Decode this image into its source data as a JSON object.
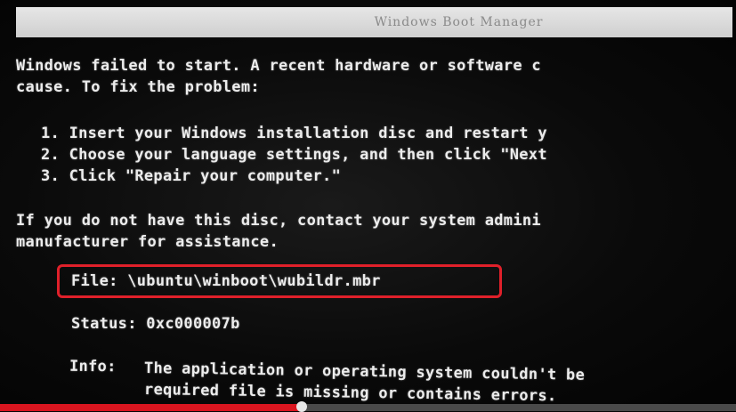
{
  "window": {
    "title": "Windows Boot Manager"
  },
  "message": {
    "line1": "Windows failed to start. A recent hardware or software c",
    "line2": "cause. To fix the problem:",
    "steps": [
      "1. Insert your Windows installation disc and restart y",
      "2. Choose your language settings, and then click \"Next",
      "3. Click \"Repair your computer.\""
    ],
    "line3": "If you do not have this disc, contact your system admini",
    "line4": "manufacturer for assistance."
  },
  "file": {
    "label": "File:",
    "value": "\\ubuntu\\winboot\\wubildr.mbr"
  },
  "status": {
    "label": "Status:",
    "value": "0xc000007b"
  },
  "info": {
    "label": "Info:",
    "line1": "The application or operating system couldn't be",
    "line2": "required file is missing or contains errors."
  },
  "video_player": {
    "progress_fraction": 0.41
  },
  "colors": {
    "highlight_border": "#e0202a",
    "progress": "#d9151f"
  }
}
